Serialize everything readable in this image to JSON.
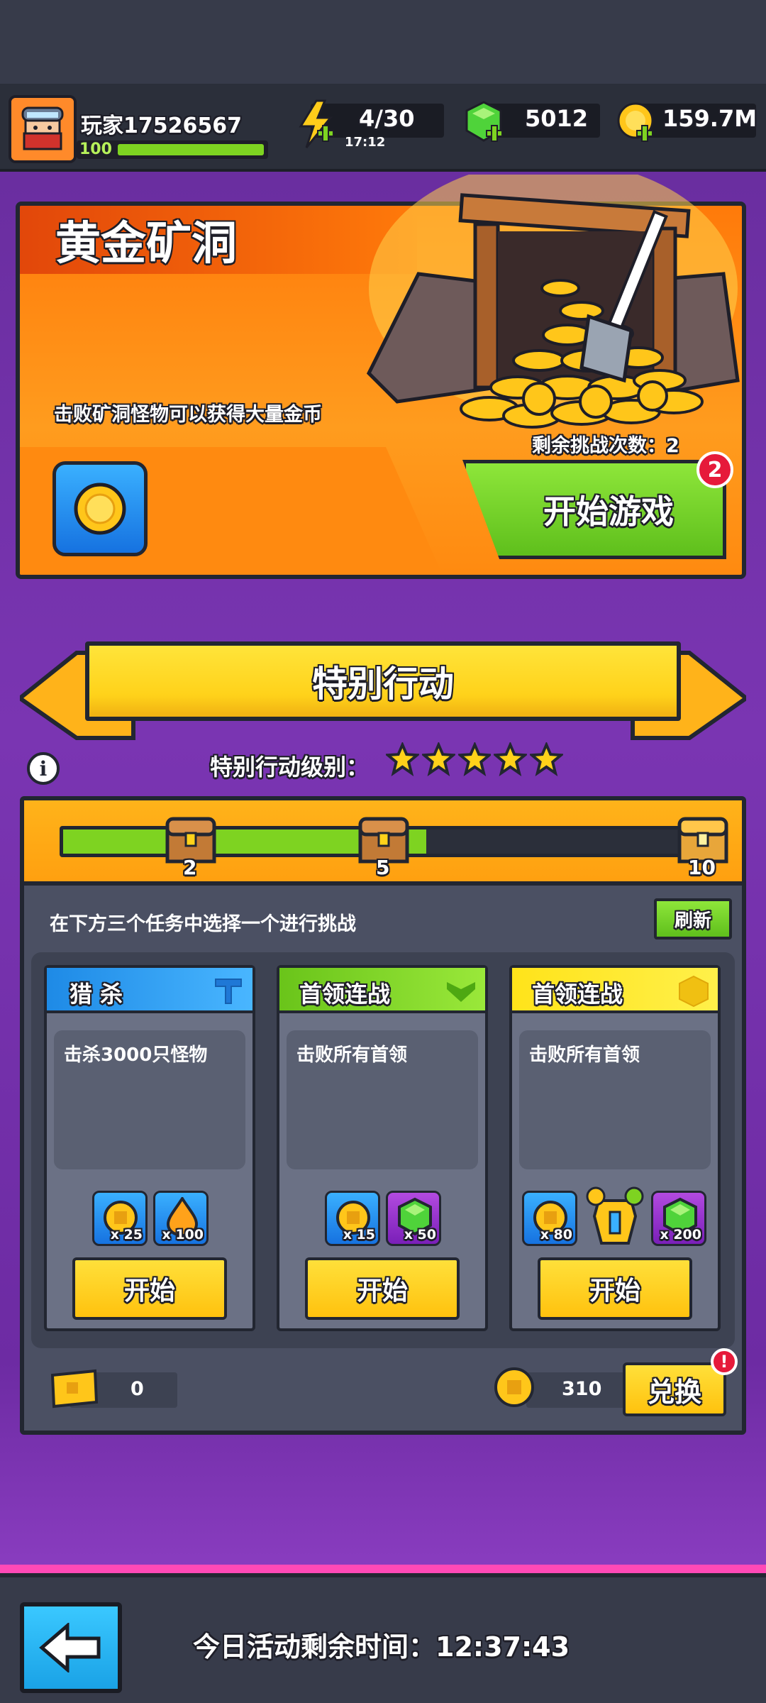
{
  "header": {
    "player_name": "玩家17526567",
    "level": "100",
    "energy": "4/30",
    "energy_timer": "17:12",
    "gems": "5012",
    "coins": "159.7M"
  },
  "gold_mine": {
    "title": "黄金矿洞",
    "description": "击败矿洞怪物可以获得大量金币",
    "remaining_label": "剩余挑战次数：2",
    "start_label": "开始游戏",
    "badge": "2"
  },
  "special_ops": {
    "banner": "特别行动",
    "level_label": "特别行动级别：",
    "stars": 5,
    "progress_fraction": 0.55,
    "milestones": [
      "2",
      "5",
      "10"
    ],
    "instruction": "在下方三个任务中选择一个进行挑战",
    "refresh_label": "刷新",
    "missions": [
      {
        "title": "猎 杀",
        "desc": "击杀3000只怪物",
        "color": "#2aa8ff",
        "rewards": [
          {
            "icon": "coin-chest-icon",
            "qty": "x 25"
          },
          {
            "icon": "flame-drop-icon",
            "qty": "x 100"
          }
        ],
        "start_label": "开始"
      },
      {
        "title": "首领连战",
        "desc": "击败所有首领",
        "color": "#7ed321",
        "rewards": [
          {
            "icon": "coin-chest-icon",
            "qty": "x 15"
          },
          {
            "icon": "gem-icon",
            "qty": "x 50"
          }
        ],
        "start_label": "开始"
      },
      {
        "title": "首领连战",
        "desc": "击败所有首领",
        "color": "#ffe31a",
        "rewards": [
          {
            "icon": "coin-chest-icon",
            "qty": "x 80"
          },
          {
            "icon": "armor-shield-icon",
            "qty": ""
          },
          {
            "icon": "gem-icon",
            "qty": "x 200"
          }
        ],
        "start_label": "开始"
      }
    ],
    "ticket_count": "0",
    "token_count": "310",
    "exchange_label": "兑换"
  },
  "footer": {
    "timer_label": "今日活动剩余时间：12:37:43"
  },
  "colors": {
    "purple": "#7a35b2",
    "orange": "#ff8a0c",
    "green_btn": "#7ed321",
    "yellow": "#ffd21a"
  }
}
